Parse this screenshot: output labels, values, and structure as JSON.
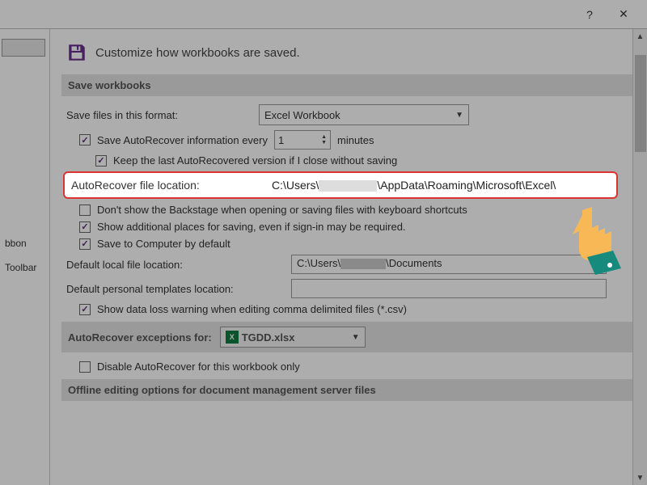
{
  "titlebar": {
    "help": "?",
    "close": "✕"
  },
  "leftnav": {
    "a": "bbon",
    "b": "Toolbar"
  },
  "heading": {
    "text": "Customize how workbooks are saved."
  },
  "sections": {
    "save_workbooks": "Save workbooks",
    "autorec_exceptions": "AutoRecover exceptions for:",
    "offline": "Offline editing options for document management server files"
  },
  "labels": {
    "save_format": "Save files in this format:",
    "save_autorec": "Save AutoRecover information every",
    "minutes": "minutes",
    "keep_last": "Keep the last AutoRecovered version if I close without saving",
    "autorec_loc": "AutoRecover file location:",
    "no_backstage": "Don't show the Backstage when opening or saving files with keyboard shortcuts",
    "show_additional": "Show additional places for saving, even if sign-in may be required.",
    "save_computer": "Save to Computer by default",
    "default_local": "Default local file location:",
    "default_templates": "Default personal templates location:",
    "csv_warning": "Show data loss warning when editing comma delimited files (*.csv)",
    "exceptions_file": "TGDD.xlsx",
    "disable_autorec": "Disable AutoRecover for this workbook only"
  },
  "values": {
    "format": "Excel Workbook",
    "autorec_minutes": "1",
    "autorec_path_a": "C:\\Users\\",
    "autorec_path_b": "\\AppData\\Roaming\\Microsoft\\Excel\\",
    "default_local_a": "C:\\Users\\",
    "default_local_b": "\\Documents",
    "templates": ""
  }
}
